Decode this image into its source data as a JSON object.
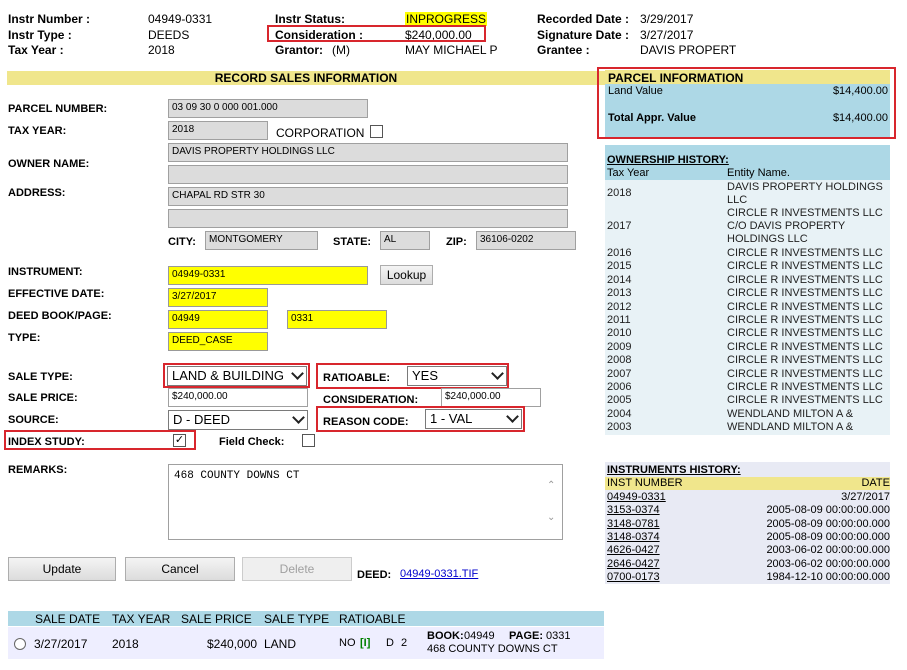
{
  "header": {
    "instr_number_label": "Instr Number :",
    "instr_number": "04949-0331",
    "instr_type_label": "Instr Type :",
    "instr_type": "DEEDS",
    "tax_year_label": "Tax Year :",
    "tax_year": "2018",
    "instr_status_label": "Instr Status:",
    "instr_status": "INPROGRESS",
    "consideration_label": "Consideration :",
    "consideration": "$240,000.00",
    "grantor_label": "Grantor:",
    "grantor_code": "(M)",
    "grantor": "MAY MICHAEL P",
    "recorded_date_label": "Recorded Date :",
    "recorded_date": "3/29/2017",
    "signature_date_label": "Signature Date :",
    "signature_date": "3/27/2017",
    "grantee_label": "Grantee :",
    "grantee": "DAVIS PROPERT"
  },
  "form": {
    "section_title": "RECORD SALES INFORMATION",
    "parcel_number_label": "PARCEL NUMBER:",
    "parcel_number": "03 09 30 0 000 001.000",
    "tax_year_label": "TAX YEAR:",
    "tax_year": "2018",
    "corporation_label": "CORPORATION",
    "owner_name_label": "OWNER NAME:",
    "owner_name": "DAVIS PROPERTY HOLDINGS LLC",
    "owner_name2": "",
    "address_label": "ADDRESS:",
    "address1": "CHAPAL RD STR 30",
    "address2": "",
    "city_label": "CITY:",
    "city": "MONTGOMERY",
    "state_label": "STATE:",
    "state": "AL",
    "zip_label": "ZIP:",
    "zip": "36106-0202",
    "instrument_label": "INSTRUMENT:",
    "instrument": "04949-0331",
    "lookup_label": "Lookup",
    "effective_date_label": "EFFECTIVE DATE:",
    "effective_date": "3/27/2017",
    "deed_book_page_label": "DEED BOOK/PAGE:",
    "deed_book": "04949",
    "deed_page": "0331",
    "type_label": "TYPE:",
    "type": "DEED_CASE",
    "sale_type_label": "SALE TYPE:",
    "sale_type": "LAND & BUILDING",
    "ratioable_label": "RATIOABLE:",
    "ratioable": "YES",
    "sale_price_label": "SALE PRICE:",
    "sale_price": "$240,000.00",
    "consideration_label": "CONSIDERATION:",
    "consideration": "$240,000.00",
    "source_label": "SOURCE:",
    "source": "D - DEED",
    "reason_code_label": "REASON CODE:",
    "reason_code": "1 - VAL",
    "index_study_label": "INDEX STUDY:",
    "field_check_label": "Field Check:",
    "remarks_label": "REMARKS:",
    "remarks": "468 COUNTY DOWNS CT",
    "update_label": "Update",
    "cancel_label": "Cancel",
    "delete_label": "Delete",
    "deed_label": "DEED:",
    "deed_link": "04949-0331.TIF"
  },
  "sales_table": {
    "headers": [
      "SALE DATE",
      "TAX YEAR",
      "SALE PRICE",
      "SALE TYPE",
      "RATIOABLE"
    ],
    "row": {
      "sale_date": "3/27/2017",
      "tax_year": "2018",
      "sale_price": "$240,000",
      "sale_type": "LAND",
      "ratioable": "NO",
      "flag": "[I]",
      "d": "D",
      "num": "2",
      "book_label": "BOOK:",
      "book": "04949",
      "page_label": "PAGE:",
      "page": "0331",
      "address": "468 COUNTY DOWNS CT"
    }
  },
  "parcel_info": {
    "title": "PARCEL INFORMATION",
    "land_value_label": "Land Value",
    "land_value": "$14,400.00",
    "total_label": "Total Appr. Value",
    "total_value": "$14,400.00"
  },
  "ownership_history": {
    "title": "OWNERSHIP HISTORY:",
    "col_year": "Tax Year",
    "col_entity": "Entity Name.",
    "rows": [
      {
        "year": "2018",
        "entity": "DAVIS PROPERTY HOLDINGS LLC"
      },
      {
        "year": "2017",
        "entity": "CIRCLE R INVESTMENTS LLC C/O DAVIS PROPERTY HOLDINGS LLC"
      },
      {
        "year": "2016",
        "entity": "CIRCLE R INVESTMENTS LLC"
      },
      {
        "year": "2015",
        "entity": "CIRCLE R INVESTMENTS LLC"
      },
      {
        "year": "2014",
        "entity": "CIRCLE R INVESTMENTS LLC"
      },
      {
        "year": "2013",
        "entity": "CIRCLE R INVESTMENTS LLC"
      },
      {
        "year": "2012",
        "entity": "CIRCLE R INVESTMENTS LLC"
      },
      {
        "year": "2011",
        "entity": "CIRCLE R INVESTMENTS LLC"
      },
      {
        "year": "2010",
        "entity": "CIRCLE R INVESTMENTS LLC"
      },
      {
        "year": "2009",
        "entity": "CIRCLE R INVESTMENTS LLC"
      },
      {
        "year": "2008",
        "entity": "CIRCLE R INVESTMENTS LLC"
      },
      {
        "year": "2007",
        "entity": "CIRCLE R INVESTMENTS LLC"
      },
      {
        "year": "2006",
        "entity": "CIRCLE R INVESTMENTS LLC"
      },
      {
        "year": "2005",
        "entity": "CIRCLE R INVESTMENTS LLC"
      },
      {
        "year": "2004",
        "entity": "WENDLAND MILTON A &"
      },
      {
        "year": "2003",
        "entity": "WENDLAND MILTON A &"
      }
    ]
  },
  "instruments_history": {
    "title": "INSTRUMENTS HISTORY:",
    "col_number": "INST NUMBER",
    "col_date": "DATE",
    "rows": [
      {
        "number": "04949-0331",
        "date": "3/27/2017"
      },
      {
        "number": "3153-0374",
        "date": "2005-08-09 00:00:00.000"
      },
      {
        "number": "3148-0781",
        "date": "2005-08-09 00:00:00.000"
      },
      {
        "number": "3148-0374",
        "date": "2005-08-09 00:00:00.000"
      },
      {
        "number": "4626-0427",
        "date": "2003-06-02 00:00:00.000"
      },
      {
        "number": "2646-0427",
        "date": "2003-06-02 00:00:00.000"
      },
      {
        "number": "0700-0173",
        "date": "1984-12-10 00:00:00.000"
      }
    ]
  },
  "colors": {
    "highlight_red": "#d8262d",
    "status_yellow": "#ffff00",
    "panel_blue": "#add8e6",
    "header_khaki": "#f0e68c"
  }
}
